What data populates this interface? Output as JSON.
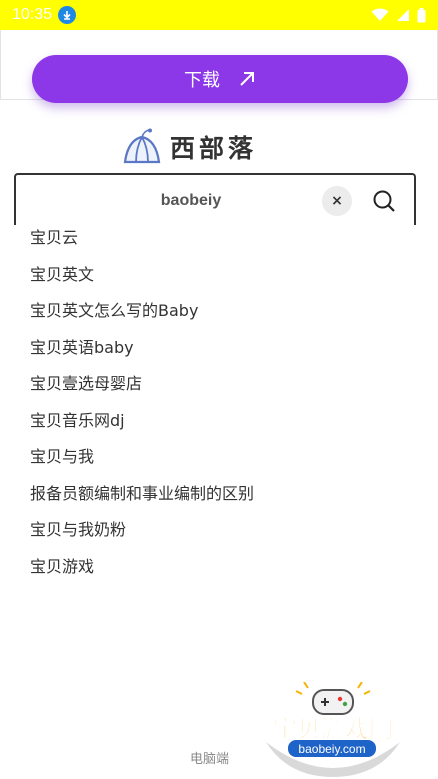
{
  "status_bar": {
    "time": "10:35"
  },
  "top": {
    "download_label": "下载"
  },
  "logo": {
    "text": "西部落"
  },
  "search": {
    "value": "baobeiy",
    "clear_glyph": "×"
  },
  "suggestions": [
    "宝贝云",
    "宝贝英文",
    "宝贝英文怎么写的Baby",
    "宝贝英语baby",
    "宝贝壹选母婴店",
    "宝贝音乐网dj",
    "宝贝与我",
    "报备员额编制和事业编制的区别",
    "宝贝与我奶粉",
    "宝贝游戏"
  ],
  "footer": {
    "link": "电脑端"
  },
  "watermark": {
    "title": "宝贝游戏网",
    "url": "baobeiy.com"
  },
  "colors": {
    "status_bar": "#ffff00",
    "accent": "#8c37e8"
  }
}
